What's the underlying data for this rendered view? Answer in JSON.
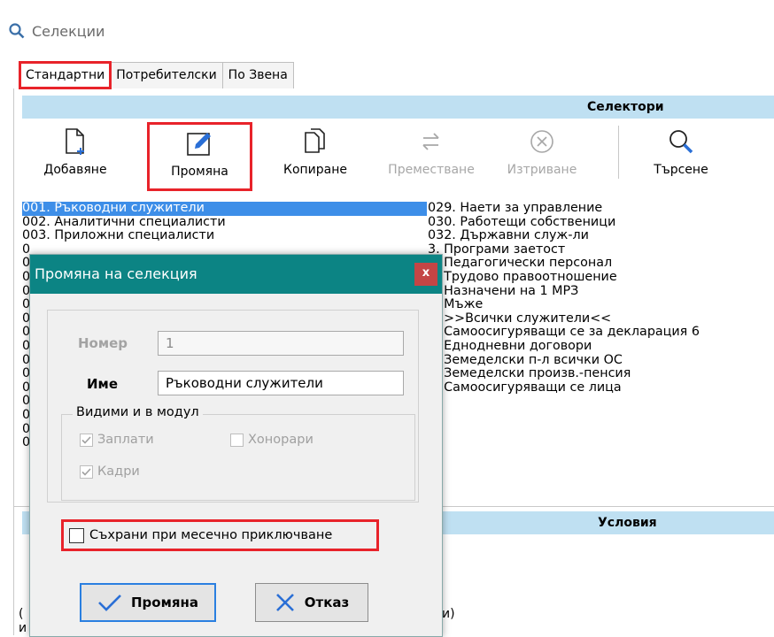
{
  "window": {
    "title": "Селекции",
    "icon": "search-icon"
  },
  "tabs": [
    {
      "label": "Стандартни",
      "active": true
    },
    {
      "label": "Потребителски",
      "active": false
    },
    {
      "label": "По Звена",
      "active": false
    }
  ],
  "selectors_header": "Селектори",
  "toolbar": {
    "add": "Добавяне",
    "edit": "Промяна",
    "copy": "Копиране",
    "move": "Преместване",
    "delete": "Изтриване",
    "search": "Търсене"
  },
  "list_left": [
    "001. Ръководни служители",
    "002. Аналитични специалисти",
    "003. Приложни специалисти",
    "0",
    "0",
    "0",
    "0",
    "0",
    "0",
    "0",
    "0",
    "0",
    "0",
    "0",
    "0",
    "0",
    "0",
    "0"
  ],
  "list_right": [
    "029. Наети за управление",
    "030. Работещи собственици",
    "032. Държавни служ-ли",
    "3. Програми заетост",
    "4. Педагогически персонал",
    "5. Трудово правоотношение",
    "6. Назначени на 1 МРЗ",
    "7. Мъже",
    "1. >>Всички служители<<",
    "6. Самоосигуряващи се за декларация 6",
    "7. Еднодневни договори",
    "8. Земеделски п-л всички ОС",
    "9. Земеделски произв.-пенсия",
    "0. Самоосигуряващи се лица"
  ],
  "conditions_header": "Условия",
  "bottom_fragments": {
    "left1": "(",
    "left2": "и",
    "right": "и)"
  },
  "dialog": {
    "title": "Промяна на селекция",
    "close": "x",
    "number_label": "Номер",
    "number_value": "1",
    "name_label": "Име",
    "name_value": "Ръководни служители",
    "modules_group": "Видими и в модул",
    "salaries": "Заплати",
    "fees": "Хонорари",
    "hr": "Кадри",
    "save_checkbox": "Съхрани при месечно приключване",
    "ok": "Промяна",
    "cancel": "Отказ"
  },
  "colors": {
    "accent": "#3d8ee8",
    "header_band": "#bfe0f2",
    "dialog_title": "#0c8484",
    "highlight": "#e8232a"
  }
}
